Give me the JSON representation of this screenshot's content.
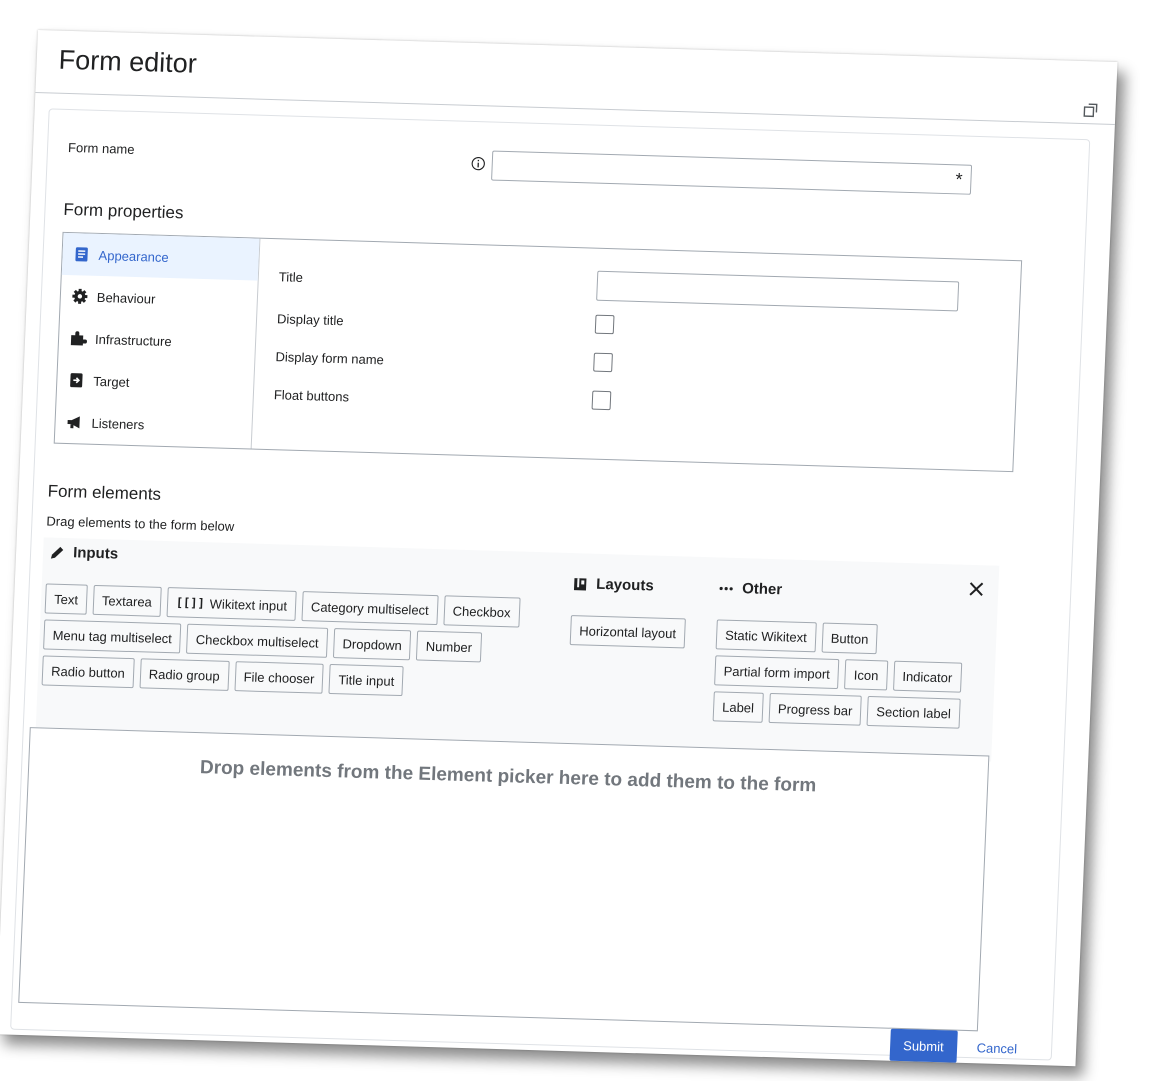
{
  "dialog": {
    "title": "Form editor"
  },
  "form_name": {
    "label": "Form name",
    "value": "",
    "required_mark": "*"
  },
  "properties": {
    "title": "Form properties",
    "menu": [
      {
        "label": "Appearance",
        "icon": "article-icon",
        "active": true
      },
      {
        "label": "Behaviour",
        "icon": "gear-icon",
        "active": false
      },
      {
        "label": "Infrastructure",
        "icon": "puzzle-icon",
        "active": false
      },
      {
        "label": "Target",
        "icon": "target-icon",
        "active": false
      },
      {
        "label": "Listeners",
        "icon": "megaphone-icon",
        "active": false
      }
    ],
    "fields": {
      "title_label": "Title",
      "title_value": "",
      "display_title_label": "Display title",
      "display_title_checked": false,
      "display_form_name_label": "Display form name",
      "display_form_name_checked": false,
      "float_buttons_label": "Float buttons",
      "float_buttons_checked": false
    }
  },
  "elements": {
    "title": "Form elements",
    "hint": "Drag elements to the form below",
    "inputs": {
      "title": "Inputs",
      "items": [
        "Text",
        "Textarea",
        "Wikitext input",
        "Category multiselect",
        "Checkbox",
        "Menu tag multiselect",
        "Checkbox multiselect",
        "Dropdown",
        "Number",
        "Radio button",
        "Radio group",
        "File chooser",
        "Title input"
      ],
      "wikitext_glyph": "[[]]"
    },
    "layouts": {
      "title": "Layouts",
      "items": [
        "Horizontal layout"
      ]
    },
    "other": {
      "title": "Other",
      "items": [
        "Static Wikitext",
        "Button",
        "Partial form import",
        "Icon",
        "Indicator",
        "Label",
        "Progress bar",
        "Section label"
      ]
    },
    "drop_placeholder": "Drop elements from the Element picker here to add them to the form"
  },
  "actions": {
    "submit": "Submit",
    "cancel": "Cancel"
  },
  "colors": {
    "accent": "#3366cc",
    "border": "#a2a9b1",
    "muted": "#72777d"
  }
}
